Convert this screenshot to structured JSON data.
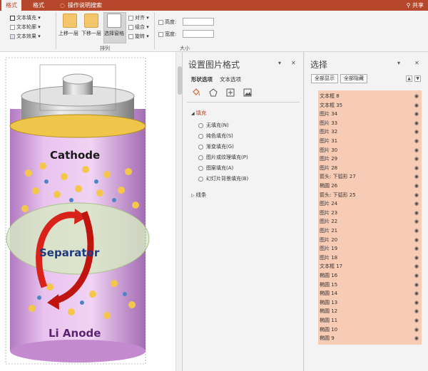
{
  "tabs": {
    "active": "格式",
    "second": "格式",
    "search": "操作说明搜索",
    "share": "共享"
  },
  "ribbon": {
    "text_fill": "文本填充",
    "text_outline": "文本轮廓",
    "text_effect": "文本效果",
    "bring_forward": "上移一层",
    "send_backward": "下移一层",
    "selection_pane": "选择窗格",
    "align": "对齐",
    "group": "组合",
    "rotate": "旋转",
    "arrange_label": "排列",
    "height_label": "高度:",
    "width_label": "宽度:",
    "size_label": "大小"
  },
  "canvas": {
    "label_cathode": "Cathode",
    "label_separator": "Separator",
    "label_anode": "Li Anode"
  },
  "format_pane": {
    "title": "设置图片格式",
    "tab_shape": "形状选项",
    "tab_text": "文本选项",
    "section_fill": "填充",
    "options": [
      "无填充(N)",
      "纯色填充(S)",
      "渐变填充(G)",
      "图片或纹理填充(P)",
      "图案填充(A)",
      "幻灯片背景填充(B)"
    ],
    "section_line": "线条"
  },
  "selection_pane": {
    "title": "选择",
    "show_all": "全部显示",
    "hide_all": "全部隐藏",
    "items": [
      "文本框 8",
      "文本框 35",
      "图片 34",
      "图片 33",
      "图片 32",
      "图片 31",
      "图片 30",
      "图片 29",
      "图片 28",
      "箭头: 下弧形 27",
      "椭圆 26",
      "箭头: 下弧形 25",
      "图片 24",
      "图片 23",
      "图片 22",
      "图片 21",
      "图片 20",
      "图片 19",
      "图片 18",
      "文本框 17",
      "椭圆 16",
      "椭圆 15",
      "椭圆 14",
      "椭圆 13",
      "椭圆 12",
      "椭圆 11",
      "椭圆 10",
      "椭圆 9"
    ]
  },
  "colors": {
    "accent": "#b7472a",
    "list_bg": "#f8cbb4",
    "battery_body": "#e0a8e6"
  }
}
